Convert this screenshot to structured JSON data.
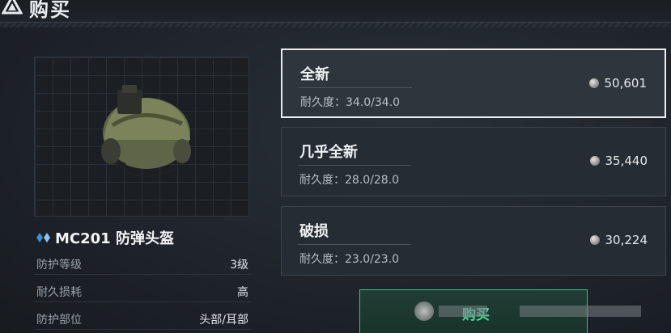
{
  "header": {
    "title": "购买"
  },
  "item": {
    "icon": "diamond-icon",
    "name": "MC201 防弹头盔",
    "stats": [
      {
        "label": "防护等级",
        "value": "3级"
      },
      {
        "label": "耐久损耗",
        "value": "高"
      },
      {
        "label": "防护部位",
        "value": "头部/耳部"
      }
    ]
  },
  "options": [
    {
      "title": "全新",
      "durability": "耐久度：34.0/34.0",
      "price": "50,601",
      "selected": true
    },
    {
      "title": "几乎全新",
      "durability": "耐久度：28.0/28.0",
      "price": "35,440",
      "selected": false
    },
    {
      "title": "破损",
      "durability": "耐久度：23.0/23.0",
      "price": "30,224",
      "selected": false
    }
  ],
  "buy_button": {
    "label": "购买"
  },
  "colors": {
    "accent": "#49e0a0",
    "background": "#1e2329",
    "option_bg": "#262c33",
    "selected_border": "#e9edf0"
  }
}
